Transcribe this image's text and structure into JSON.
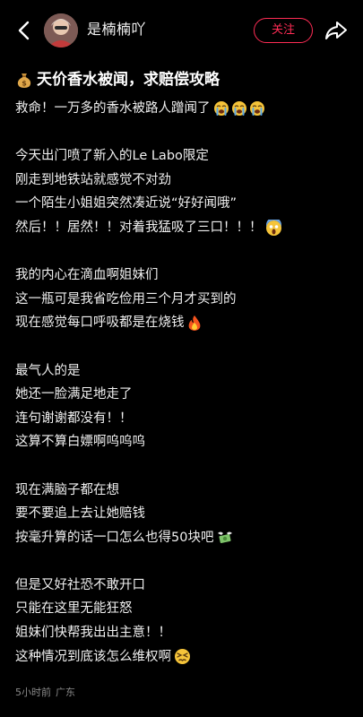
{
  "header": {
    "username": "是楠楠吖",
    "follow_label": "关注"
  },
  "post": {
    "title": "天价香水被闻，求赔偿攻略",
    "paragraphs": [
      [
        "救命！一万多的香水被路人蹭闻了"
      ],
      [
        "今天出门喷了新入的Le Labo限定",
        "刚走到地铁站就感觉不对劲",
        "一个陌生小姐姐突然凑近说“好好闻哦”",
        "然后！！居然！！对着我猛吸了三口！！！"
      ],
      [
        "我的内心在滴血啊姐妹们",
        "这一瓶可是我省吃俭用三个月才买到的",
        "现在感觉每口呼吸都是在烧钱"
      ],
      [
        "最气人的是",
        "她还一脸满足地走了",
        "连句谢谢都没有！！",
        "这算不算白嫖啊呜呜呜"
      ],
      [
        "现在满脑子都在想",
        "要不要追上去让她赔钱",
        "按毫升算的话一口怎么也得50块吧"
      ],
      [
        "但是又好社恐不敢开口",
        "只能在这里无能狂怒",
        "姐妹们快帮我出出主意！！",
        "这种情况到底该怎么维权啊"
      ]
    ]
  },
  "meta": {
    "time": "5小时前",
    "location": "广东"
  },
  "icons": {
    "back": "chevron-left-icon",
    "share": "share-arrow-icon",
    "title_emoji": "money-bag-icon",
    "cry_emoji": "loudly-crying-face-icon",
    "shock_emoji": "screaming-face-icon",
    "fire_emoji": "fire-icon",
    "money_fly_emoji": "money-with-wings-icon",
    "persevere_emoji": "persevering-face-icon"
  },
  "colors": {
    "background": "#000000",
    "accent": "#ff2c55",
    "text": "#f0f0f0",
    "meta": "#8a8a8a"
  }
}
